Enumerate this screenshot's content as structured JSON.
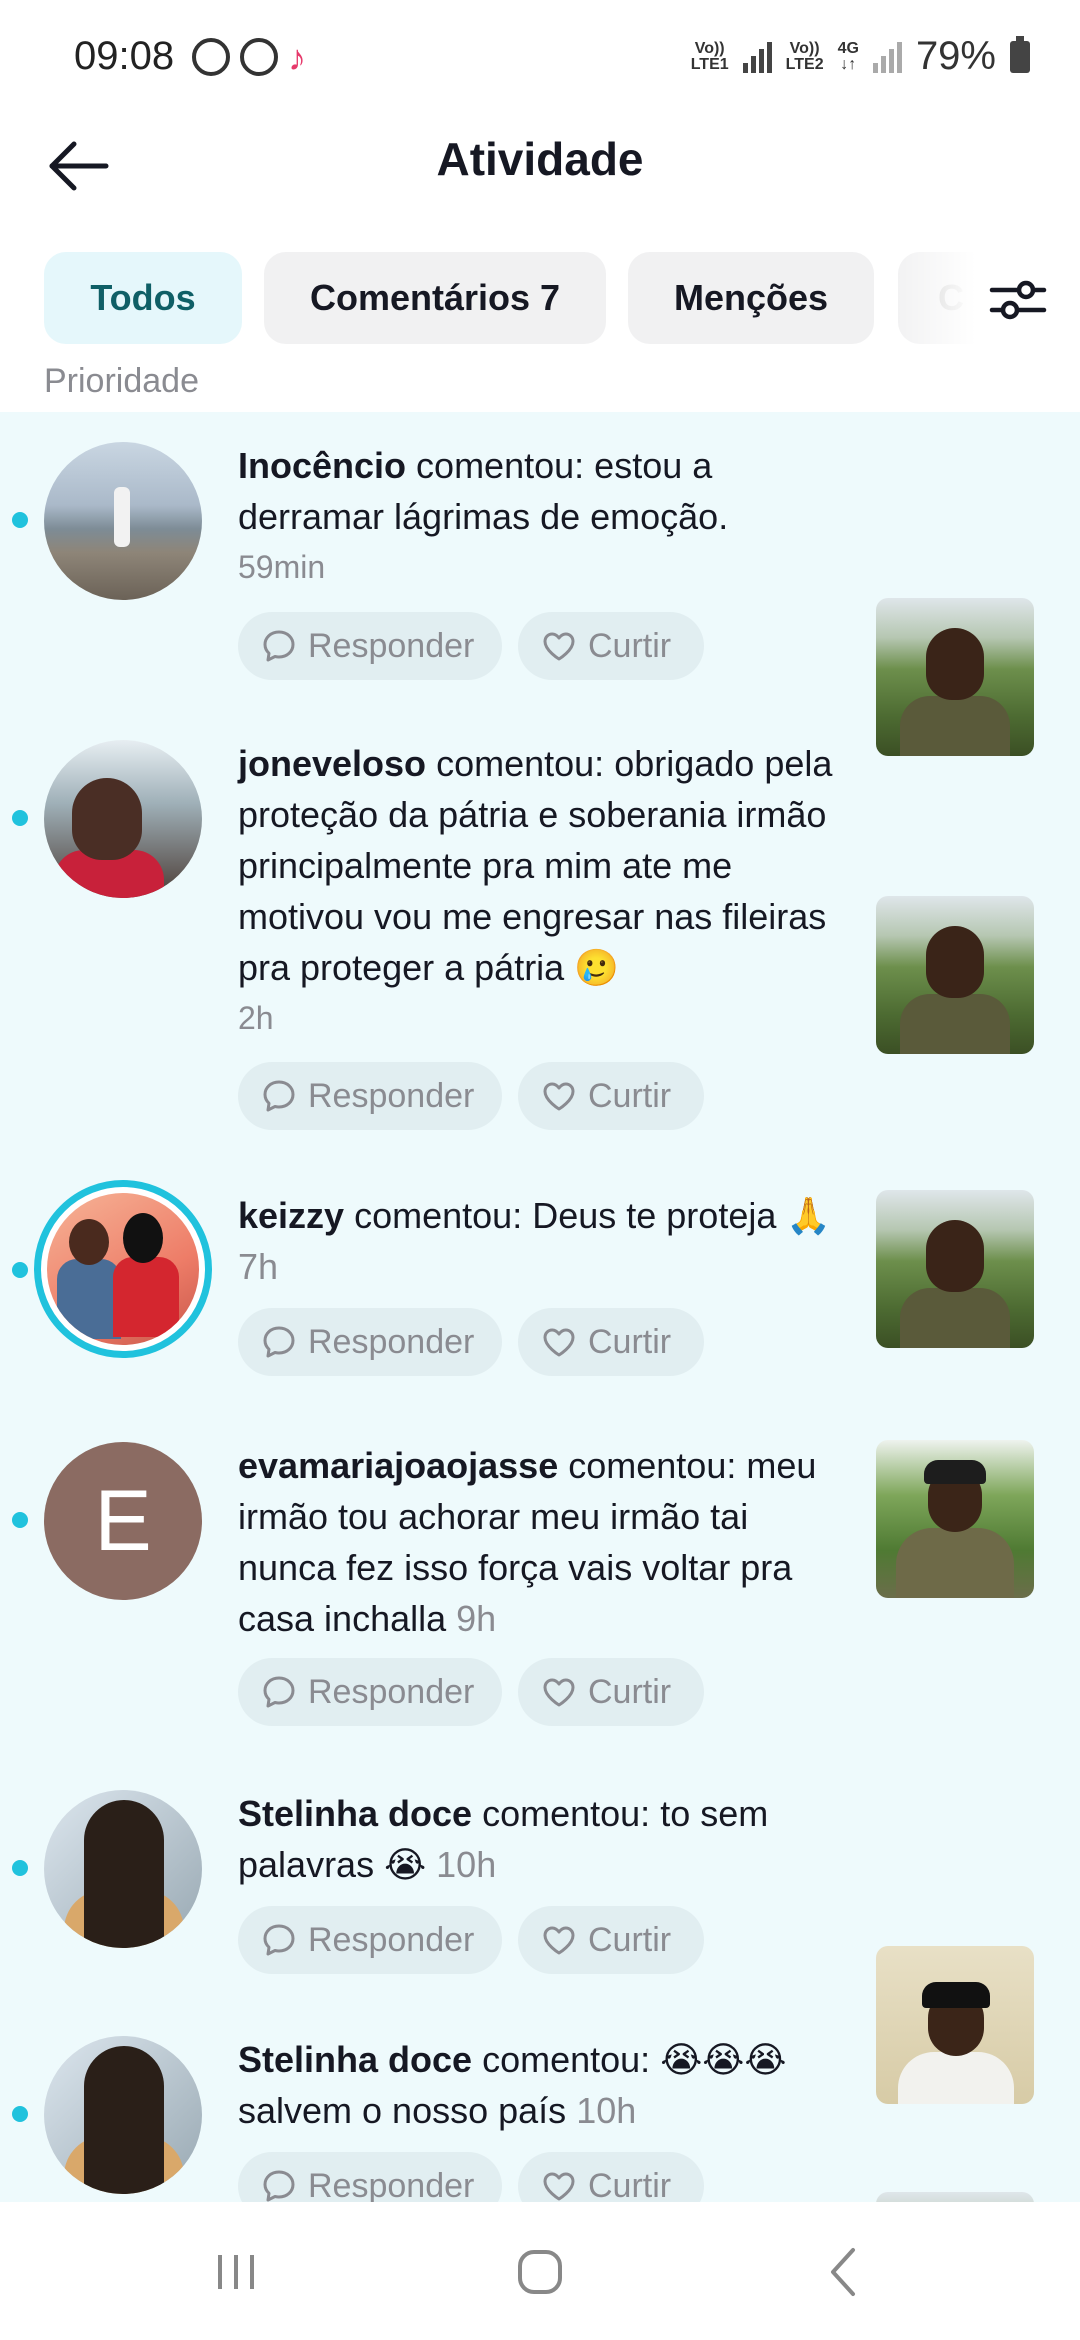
{
  "status_bar": {
    "time": "09:08",
    "net1_line1": "Vo))",
    "net1_line2": "LTE1",
    "net2_line1": "Vo))",
    "net2_line2": "LTE2",
    "net_4g": "4G",
    "battery": "79%",
    "icons": [
      "whatsapp-icon",
      "whatsapp-icon",
      "tiktok-icon"
    ]
  },
  "header": {
    "title": "Atividade"
  },
  "tabs": [
    {
      "label": "Todos",
      "active": true
    },
    {
      "label": "Comentários 7",
      "active": false
    },
    {
      "label": "Menções",
      "active": false
    },
    {
      "label": "C",
      "active": false
    }
  ],
  "section_label": "Prioridade",
  "actions": {
    "reply": "Responder",
    "like": "Curtir"
  },
  "accent_color": "#20c2dd",
  "notifications": [
    {
      "user": "Inocêncio",
      "verb": "comentou:",
      "comment": "estou a derramar lágrimas de emoção.",
      "time": "59min",
      "unread": true
    },
    {
      "user": "joneveloso",
      "verb": "comentou:",
      "comment": "obrigado pela proteção da pátria e soberania irmão principalmente pra mim ate me motivou vou me engresar nas fileiras pra proteger a pátria 🥲",
      "time": "2h",
      "unread": true
    },
    {
      "user": "keizzy",
      "verb": "comentou:",
      "comment": "Deus te proteja 🙏",
      "time": "7h",
      "unread": true
    },
    {
      "user": "evamariajoaojasse",
      "verb": "comentou:",
      "comment": "meu irmão tou achorar meu irmão tai nunca fez isso força vais voltar pra casa inchalla",
      "time": "9h",
      "avatar_letter": "E",
      "unread": true
    },
    {
      "user": "Stelinha doce",
      "verb": "comentou:",
      "comment": "to sem palavras 😭",
      "time": "10h",
      "unread": true
    },
    {
      "user": "Stelinha doce",
      "verb": "comentou:",
      "comment": "😭😭😭 salvem o nosso país",
      "time": "10h",
      "unread": true
    }
  ]
}
